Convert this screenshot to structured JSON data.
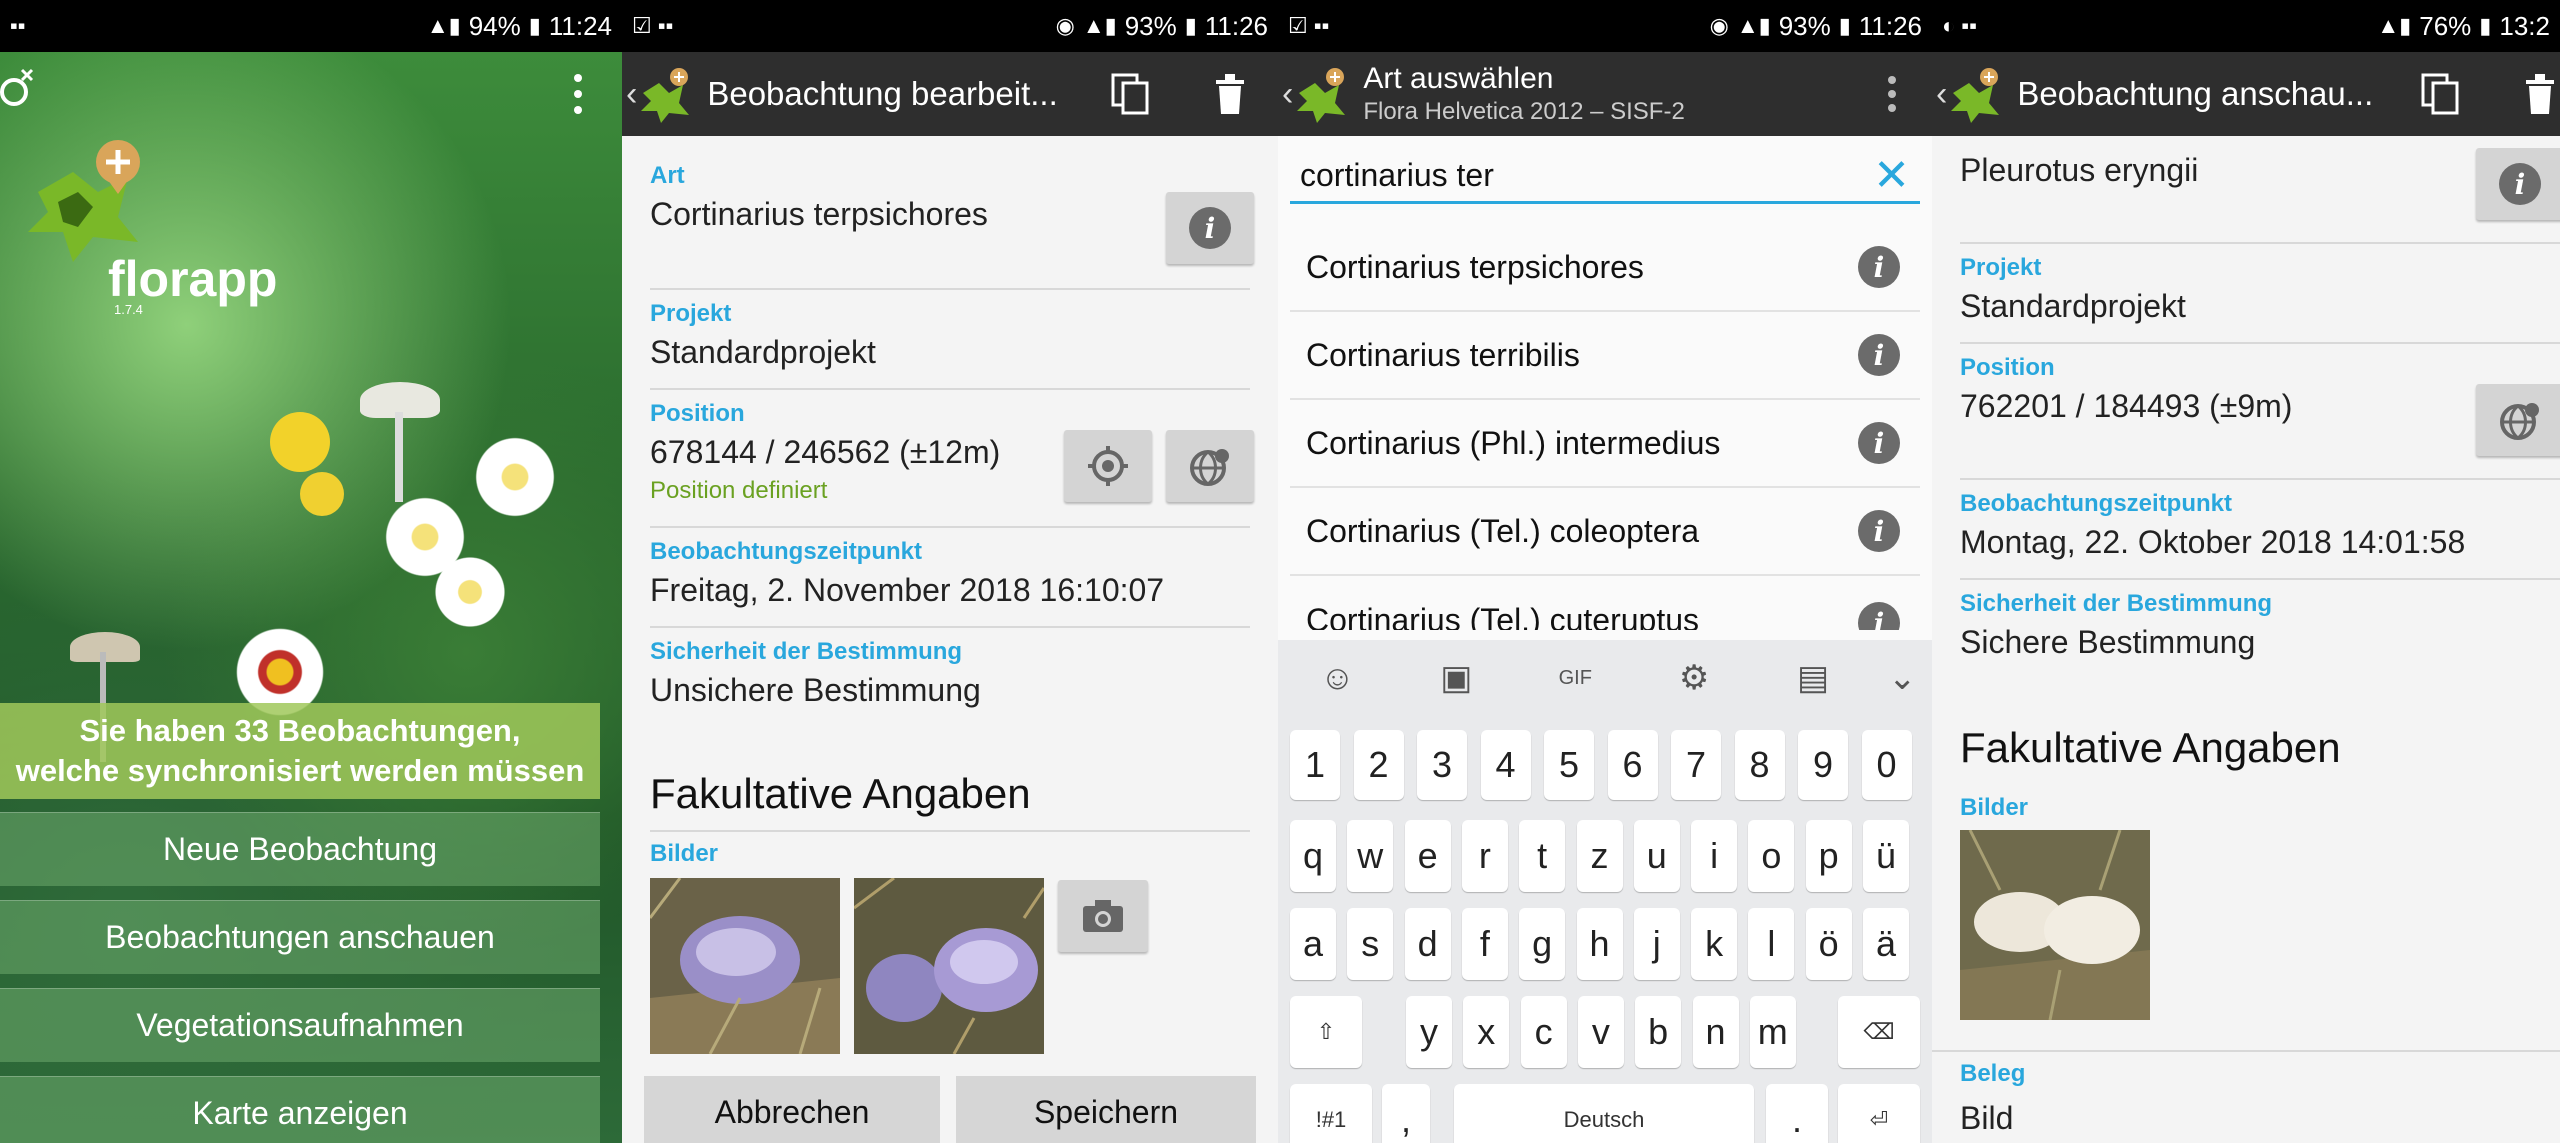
{
  "screen1": {
    "status": {
      "battery": "94%",
      "time": "11:24"
    },
    "app_name": "florapp",
    "version": "1.7.4",
    "banner": {
      "line1": "Sie haben 33 Beobachtungen,",
      "line2": "welche synchronisiert werden müssen"
    },
    "menu": [
      "Neue Beobachtung",
      "Beobachtungen anschauen",
      "Vegetationsaufnahmen",
      "Karte anzeigen"
    ]
  },
  "screen2": {
    "status": {
      "battery": "93%",
      "time": "11:26"
    },
    "title": "Beobachtung bearbeit...",
    "art_label": "Art",
    "art_value": "Cortinarius terpsichores",
    "projekt_label": "Projekt",
    "projekt_value": "Standardprojekt",
    "position_label": "Position",
    "position_value": "678144 / 246562 (±12m)",
    "position_status": "Position definiert",
    "zeit_label": "Beobachtungszeitpunkt",
    "zeit_value": "Freitag, 2. November 2018 16:10:07",
    "sicherheit_label": "Sicherheit der Bestimmung",
    "sicherheit_value": "Unsichere Bestimmung",
    "section_title": "Fakultative Angaben",
    "bilder_label": "Bilder",
    "cancel": "Abbrechen",
    "save": "Speichern"
  },
  "screen3": {
    "status": {
      "battery": "93%",
      "time": "11:26"
    },
    "title": "Art auswählen",
    "subtitle": "Flora Helvetica 2012 – SISF-2",
    "search_value": "cortinarius ter",
    "results": [
      "Cortinarius terpsichores",
      "Cortinarius terribilis",
      "Cortinarius (Phl.) intermedius",
      "Cortinarius (Tel.) coleoptera",
      "Cortinarius (Tel.) cuteruptus"
    ],
    "keyboard": {
      "row_numbers": [
        "1",
        "2",
        "3",
        "4",
        "5",
        "6",
        "7",
        "8",
        "9",
        "0"
      ],
      "row1": [
        "q",
        "w",
        "e",
        "r",
        "t",
        "z",
        "u",
        "i",
        "o",
        "p",
        "ü"
      ],
      "row2": [
        "a",
        "s",
        "d",
        "f",
        "g",
        "h",
        "j",
        "k",
        "l",
        "ö",
        "ä"
      ],
      "row3": [
        "y",
        "x",
        "c",
        "v",
        "b",
        "n",
        "m"
      ],
      "symbols_key": "!#1",
      "comma": ",",
      "space_label": "Deutsch",
      "period": "."
    }
  },
  "screen4": {
    "status": {
      "battery": "76%",
      "time": "13:2"
    },
    "title": "Beobachtung anschau...",
    "art_value": "Pleurotus eryngii",
    "projekt_label": "Projekt",
    "projekt_value": "Standardprojekt",
    "position_label": "Position",
    "position_value": "762201 / 184493 (±9m)",
    "zeit_label": "Beobachtungszeitpunkt",
    "zeit_value": "Montag, 22. Oktober 2018 14:01:58",
    "sicherheit_label": "Sicherheit der Bestimmung",
    "sicherheit_value": "Sichere Bestimmung",
    "section_title": "Fakultative Angaben",
    "bilder_label": "Bilder",
    "beleg_label": "Beleg",
    "beleg_value": "Bild"
  },
  "colors": {
    "accent": "#29a7dd",
    "appbar": "#2e2e2e",
    "status_ok": "#6aa121"
  }
}
